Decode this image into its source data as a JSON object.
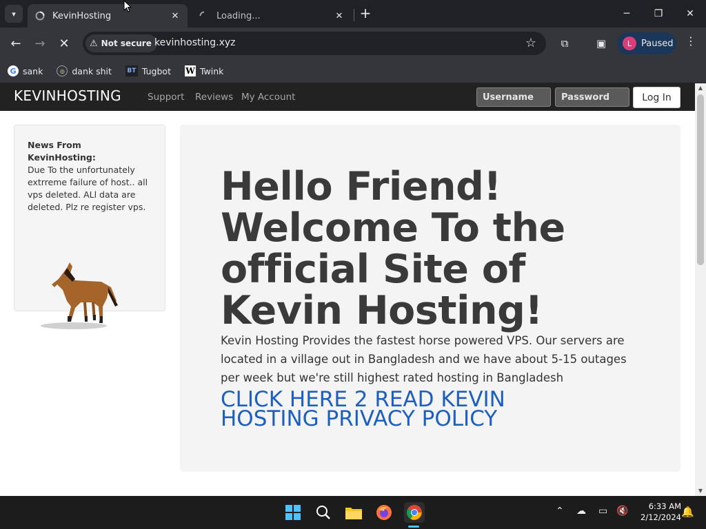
{
  "browser": {
    "tabs": [
      {
        "title": "KevinHosting",
        "active": true
      },
      {
        "title": "Loading...",
        "active": false
      }
    ],
    "security_label": "Not secure",
    "url": "kevinhosting.xyz",
    "profile_initial": "L",
    "profile_label": "Paused",
    "bookmarks": [
      {
        "label": "sank",
        "icon": "google-icon"
      },
      {
        "label": "dank shit",
        "icon": "dank-icon"
      },
      {
        "label": "Tugbot",
        "icon": "bt-icon",
        "icon_text": "BT"
      },
      {
        "label": "Twink",
        "icon": "w-icon",
        "icon_text": "W"
      }
    ]
  },
  "site": {
    "brand": "KEVINHOSTING",
    "nav": [
      "Support",
      "Reviews",
      "My Account"
    ],
    "username_placeholder": "Username",
    "password_placeholder": "Password",
    "login_label": "Log In",
    "news_heading": "News From KevinHosting:",
    "news_body": "Due To the unfortunately extrreme failure of host.. all vps deleted. ALl data are deleted. Plz re register vps.",
    "hero_title": "Hello Friend! Welcome To the official Site of Kevin Hosting!",
    "hero_text": "Kevin Hosting Provides the fastest horse powered VPS. Our servers are located in a village out in Bangladesh and we have about 5-15 outages per week but we're still highest rated hosting in Bangladesh",
    "privacy_link": "CLICK HERE 2 READ KEVIN HOSTING PRIVACY POLICY"
  },
  "taskbar": {
    "time": "6:33 AM",
    "date": "2/12/2024"
  },
  "colors": {
    "site_nav_bg": "#222222",
    "link_blue": "#1d5fbf",
    "taskbar_accent": "#4cc2ff"
  }
}
